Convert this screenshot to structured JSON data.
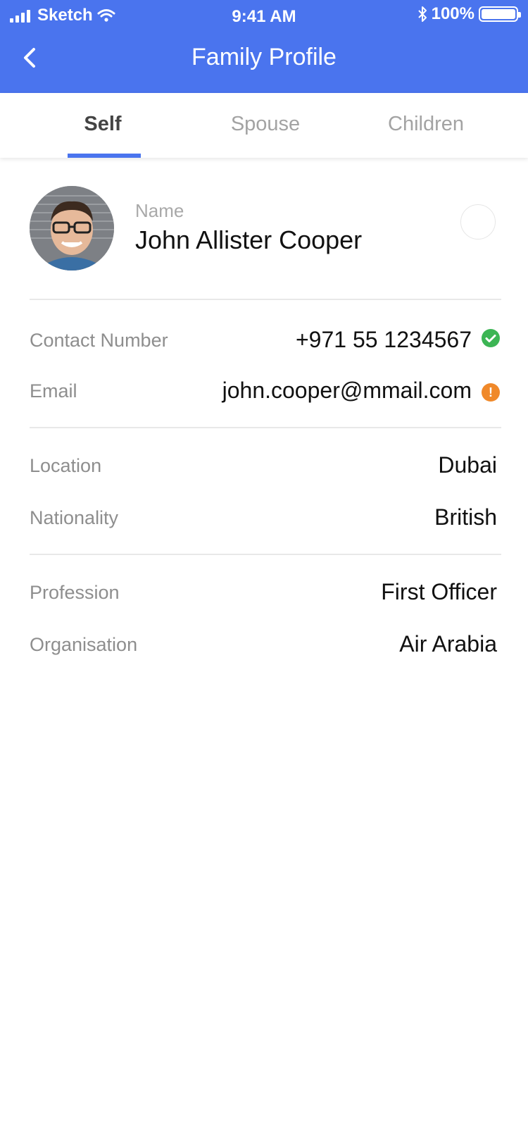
{
  "status_bar": {
    "carrier": "Sketch",
    "time": "9:41 AM",
    "battery": "100%"
  },
  "header": {
    "title": "Family Profile",
    "background_color": "#4a74ee"
  },
  "tabs": [
    {
      "label": "Self",
      "active": true
    },
    {
      "label": "Spouse",
      "active": false
    },
    {
      "label": "Children",
      "active": false
    }
  ],
  "profile": {
    "name_label": "Name",
    "name": "John Allister Cooper"
  },
  "contact": {
    "phone_label": "Contact Number",
    "phone": "+971 55 1234567",
    "phone_status": "verified",
    "phone_status_color": "#3cb554",
    "email_label": "Email",
    "email": "john.cooper@mmail.com",
    "email_status": "unverified",
    "email_status_color": "#f0892a",
    "email_status_glyph": "!"
  },
  "location": {
    "location_label": "Location",
    "location": "Dubai",
    "nationality_label": "Nationality",
    "nationality": "British"
  },
  "work": {
    "profession_label": "Profession",
    "profession": "First Officer",
    "organisation_label": "Organisation",
    "organisation": "Air Arabia"
  }
}
